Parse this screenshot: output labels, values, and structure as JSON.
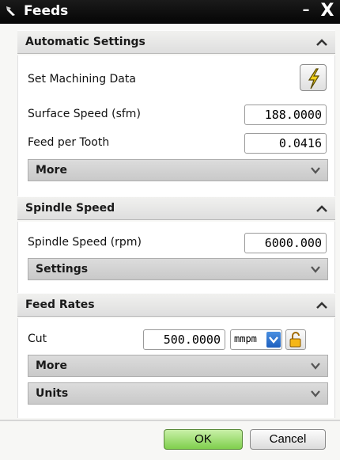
{
  "window": {
    "title": "Feeds",
    "minimize_label": "–",
    "close_label": "X"
  },
  "automatic_settings": {
    "title": "Automatic Settings",
    "set_machining_label": "Set Machining Data",
    "surface_speed_label": "Surface Speed (sfm)",
    "surface_speed_value": "188.0000",
    "feed_per_tooth_label": "Feed per Tooth",
    "feed_per_tooth_value": "0.0416",
    "more_label": "More"
  },
  "spindle_speed": {
    "title": "Spindle Speed",
    "rpm_label": "Spindle Speed (rpm)",
    "rpm_value": "6000.000",
    "settings_label": "Settings"
  },
  "feed_rates": {
    "title": "Feed Rates",
    "cut_label": "Cut",
    "cut_value": "500.0000",
    "cut_unit": "mmpm",
    "more_label": "More",
    "units_label": "Units"
  },
  "footer": {
    "ok_label": "OK",
    "cancel_label": "Cancel"
  },
  "colors": {
    "titlebar": "#0d0d0d",
    "ok_green": "#7fcf4d",
    "dropdown_blue": "#1d5fbf",
    "lightning_yellow": "#f2d21a"
  },
  "icons": {
    "title": "scroll-window-icon",
    "set_machining": "lightning-icon",
    "collapse": "chevron-up-icon",
    "expand": "chevron-down-icon",
    "lock": "padlock-icon"
  }
}
